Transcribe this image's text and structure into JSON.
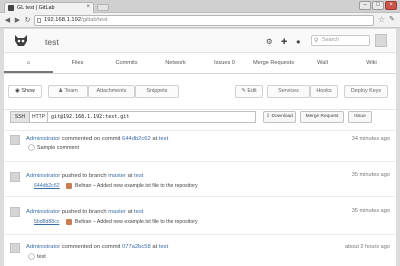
{
  "browser": {
    "tab_title": "GL test | GitLab",
    "url_host": "192.168.1.192",
    "url_path": "/gitlab/test"
  },
  "header": {
    "project_title": "test",
    "search_placeholder": "Search"
  },
  "main_nav": [
    {
      "label": "",
      "icon": "home-icon"
    },
    {
      "label": "Files"
    },
    {
      "label": "Commits"
    },
    {
      "label": "Network"
    },
    {
      "label": "Issues  0"
    },
    {
      "label": "Merge Requests"
    },
    {
      "label": "Wall"
    },
    {
      "label": "Wiki"
    }
  ],
  "sub_nav": {
    "show": "Show",
    "team": "Team",
    "attachments": "Attachments",
    "snippets": "Snippets",
    "edit": "Edit",
    "services": "Services",
    "hooks": "Hooks",
    "deploy_keys": "Deploy Keys"
  },
  "clone": {
    "ssh": "SSH",
    "http": "HTTP",
    "url": "git@192.168.1.192:test.git",
    "download": "Download",
    "merge_request": "Merge Request",
    "issue": "Issue"
  },
  "events": [
    {
      "author": "Administrator",
      "action": "commented on commit",
      "ref": "644db2c62",
      "at": "at",
      "project": "test",
      "time": "34 minutes ago",
      "body": "Sample comment"
    },
    {
      "author": "Administrator",
      "action": "pushed to branch",
      "ref": "master",
      "at": "at",
      "project": "test",
      "time": "35 minutes ago",
      "sha": "644db2c62",
      "commit_msg": "Beltran – Added new example.txt file to the repository"
    },
    {
      "author": "Administrator",
      "action": "pushed to branch",
      "ref": "master",
      "at": "at",
      "project": "test",
      "time": "35 minutes ago",
      "sha": "5bd8d88cc",
      "commit_msg": "Beltran – Added new example.txt file to the repository"
    },
    {
      "author": "Administrator",
      "action": "commented on commit",
      "ref": "077a2bc58",
      "at": "at",
      "project": "test",
      "time": "about 2 hours ago",
      "body": "test"
    }
  ]
}
